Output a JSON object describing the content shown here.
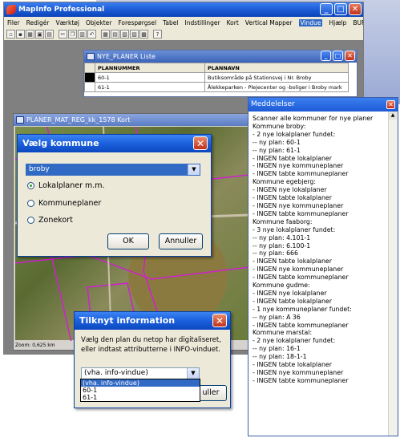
{
  "app": {
    "title": "MapInfo Professional"
  },
  "menu": [
    "Filer",
    "Redigér",
    "Værktøj",
    "Objekter",
    "Forespørgsel",
    "Tabel",
    "Indstillinger",
    "Kort",
    "Vertical Mapper",
    "Vindue",
    "Hjælp",
    "BUF-plan"
  ],
  "menu_active": "Vindue",
  "list_window": {
    "title": "NYE_PLANER Liste",
    "headers": [
      "PLANNUMMER",
      "PLANNAVN"
    ],
    "rows": [
      {
        "num": "60-1",
        "name": "Butiksområde på Stationsvej i Nr. Broby"
      },
      {
        "num": "61-1",
        "name": "Ålekkeparken - Plejecenter og -boliger i Broby mark"
      }
    ]
  },
  "map_window": {
    "title": "PLANER_MAT_REG_kk_1578 Kort",
    "status": "Zoom: 0,625 km"
  },
  "dialog_kommune": {
    "title": "Vælg kommune",
    "combo_value": "broby",
    "options": [
      "Lokalplaner m.m.",
      "Kommuneplaner",
      "Zonekort"
    ],
    "selected_index": 0,
    "ok": "OK",
    "cancel": "Annuller"
  },
  "dialog_info": {
    "title": "Tilknyt information",
    "text1": "Vælg den plan du netop har digitaliseret,",
    "text2": "eller indtast attributterne i INFO-vinduet.",
    "combo_value": "(vha. info-vindue)",
    "dropdown": [
      "(vha. info-vindue)",
      "60-1",
      "61-1"
    ],
    "cancel_partial": "uller"
  },
  "messages": {
    "title": "Meddelelser",
    "lines": [
      "Scanner alle kommuner for nye planer",
      "Kommune broby:",
      "- 2 nye lokalplaner fundet:",
      " -- ny plan: 60-1",
      " -- ny plan: 61-1",
      "- INGEN tabte lokalplaner",
      "- INGEN nye kommuneplaner",
      "- INGEN tabte kommuneplaner",
      "Kommune egebjerg:",
      "- INGEN nye lokalplaner",
      "- INGEN tabte lokalplaner",
      "- INGEN nye kommuneplaner",
      "- INGEN tabte kommuneplaner",
      "Kommune faaborg:",
      "- 3 nye lokalplaner fundet:",
      " -- ny plan: 4.101-1",
      " -- ny plan: 6.100-1",
      " -- ny plan: 666",
      "- INGEN tabte lokalplaner",
      "- INGEN nye kommuneplaner",
      "- INGEN tabte kommuneplaner",
      "Kommune gudme:",
      "- INGEN nye lokalplaner",
      "- INGEN tabte lokalplaner",
      "- 1 nye kommuneplaner fundet:",
      " -- ny plan: A 36",
      "- INGEN tabte kommuneplaner",
      "Kommune marstal:",
      "- 2 nye lokalplaner fundet:",
      " -- ny plan: 16-1",
      " -- ny plan: 18-1-1",
      "- INGEN tabte lokalplaner",
      "- INGEN nye kommuneplaner",
      "- INGEN tabte kommuneplaner"
    ]
  }
}
